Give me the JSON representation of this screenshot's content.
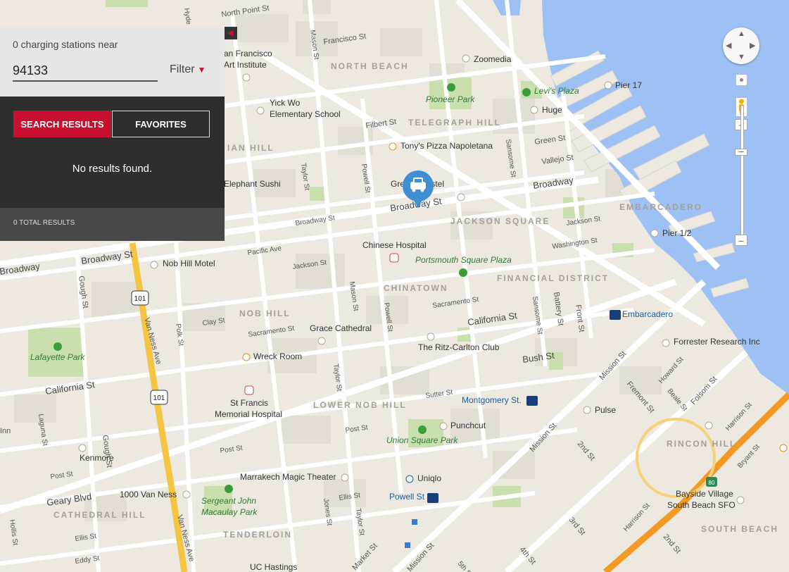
{
  "panel": {
    "near_text": "0 charging stations near",
    "zip_value": "94133",
    "filter_label": "Filter",
    "tabs": [
      {
        "label": "SEARCH RESULTS"
      },
      {
        "label": "FAVORITES"
      }
    ],
    "no_results": "No results found.",
    "total_results": "0 TOTAL RESULTS"
  },
  "colors": {
    "accent": "#c8102e",
    "panel_dark": "#2e2e2e",
    "map_bg": "#ede9e0",
    "water": "#9ec1f5",
    "highway": "#f4c542",
    "freeway": "#f29a23",
    "park": "#c9dfae"
  },
  "map": {
    "districts": {
      "north_beach": "NORTH BEACH",
      "telegraph_hill": "TELEGRAPH HILL",
      "russian_hill": "IAN HILL",
      "jackson_square": "JACKSON SQUARE",
      "embarcadero": "EMBARCADERO",
      "financial_district": "FINANCIAL DISTRICT",
      "chinatown": "CHINATOWN",
      "nob_hill": "NOB HILL",
      "lower_nob_hill": "LOWER NOB HILL",
      "rincon_hill": "RINCON HILL",
      "cathedral_hill": "CATHEDRAL HILL",
      "tenderloin": "TENDERLOIN",
      "south_beach": "SOUTH BEACH"
    },
    "streets": {
      "north_point": "North Point St",
      "francisco": "Francisco St",
      "filbert": "Filbert St",
      "green": "Green St",
      "vallejo": "Vallejo St",
      "broadway_e": "Broadway",
      "broadway_mid": "Broadway St",
      "broadway_small": "Broadway St",
      "broadway_w": "Broadway St",
      "broadway_far_w": "Broadway",
      "pacific": "Pacific Ave",
      "jackson": "Jackson St",
      "jackson_e": "Jackson St",
      "washington": "Washington St",
      "clay": "Clay St",
      "sacramento": "Sacramento St",
      "sacramento_w": "Sacramento St",
      "california": "California St",
      "california_w": "California St",
      "bush": "Bush St",
      "sutter": "Sutter St",
      "post": "Post St",
      "post_w": "Post St",
      "geary": "Geary Blvd",
      "ellis": "Ellis St",
      "ellis_w": "Ellis St",
      "eddy": "Eddy St",
      "gough": "Gough St",
      "gough_s": "Gough St",
      "polk": "Polk St",
      "van_ness": "Van Ness Ave",
      "van_ness_s": "Van Ness Ave",
      "mason": "Mason St",
      "mason_s": "Mason St",
      "taylor": "Taylor St",
      "taylor_s": "Taylor St",
      "taylor_s2": "Taylor St",
      "powell": "Powell St",
      "powell_s": "Powell St",
      "sansome": "Sansome St",
      "sansome_s": "Sansome St",
      "battery": "Battery St",
      "front": "Front St",
      "mission": "Mission St",
      "mission_w": "Mission St",
      "fremont": "Fremont St",
      "folsom": "Folsom St",
      "howard": "Howard St",
      "beale": "Beale St",
      "harrison": "Harrison St",
      "harrison_w": "Harrison St",
      "bryant": "Bryant St",
      "second": "2nd St",
      "third": "3rd St",
      "fourth": "4th St",
      "fifth": "5th St",
      "second_s": "2nd St",
      "market": "Market St",
      "jones": "Jones St",
      "laguna": "Laguna St",
      "hyde": "Hyde",
      "hollis": "Hollis St",
      "inn": "Inn",
      "ay_a": "ay",
      "ave_a": "Ave",
      "st_a": "St"
    },
    "places": {
      "art_institute_1": "an Francisco",
      "art_institute_2": "Art Institute",
      "zoomedia": "Zoomedia",
      "levis": "Levi's Plaza",
      "pier17": "Pier 17",
      "pioneer_park": "Pioneer Park",
      "huge": "Huge",
      "yick_wo_1": "Yick Wo",
      "yick_wo_2": "Elementary School",
      "tonys": "Tony's Pizza Napoletana",
      "elephant_sushi": "Elephant Sushi",
      "green_hostel": "Gre  ise Hostel",
      "pier12": "Pier 1/2",
      "chinese_hospital": "Chinese Hospital",
      "portsmouth": "Portsmouth Square Plaza",
      "nob_hill_motel": "Nob Hill Motel",
      "embarcadero_station": "Embarcadero",
      "grace_cathedral": "Grace Cathedral",
      "ritz": "The Ritz-Carlton Club",
      "forrester": "Forrester Research Inc",
      "lafayette": "Lafayette Park",
      "wreck_room": "Wreck Room",
      "montgomery": "Montgomery St.",
      "pulse": "Pulse",
      "st_francis_1": "St Francis",
      "st_francis_2": "Memorial Hospital",
      "punchcut": "Punchcut",
      "union_square": "Union Square Park",
      "kenmore": "Kenmore",
      "marrakech": "Marrakech Magic Theater",
      "uniqlo": "Uniqlo",
      "van_ness_1000": "1000 Van Ness",
      "sergeant_1": "Sergeant John",
      "sergeant_2": "Macaulay Park",
      "powell_station": "Powell St",
      "bayside_1": "Bayside Village",
      "bayside_2": "South Beach SFO",
      "uc_hastings": "UC Hastings"
    },
    "shields": {
      "us101_a": "101",
      "us101_b": "101",
      "i80": "80"
    }
  }
}
